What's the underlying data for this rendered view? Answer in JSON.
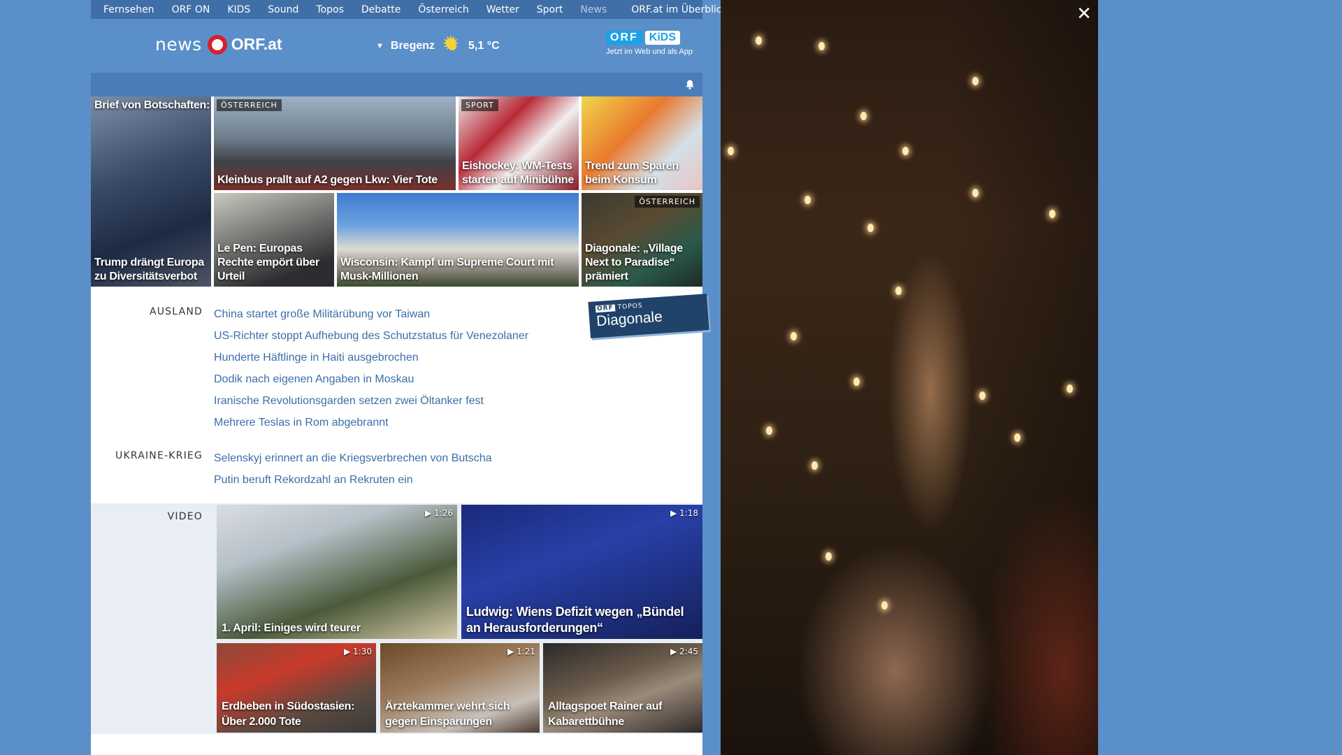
{
  "topnav": {
    "items": [
      "Fernsehen",
      "ORF ON",
      "KIDS",
      "Sound",
      "Topos",
      "Debatte",
      "Österreich",
      "Wetter",
      "Sport",
      "News"
    ],
    "overview": "ORF.at im Überblick"
  },
  "header": {
    "logo_news": "news",
    "logo_orf": "ORF.at",
    "weather_location": "Bregenz",
    "weather_temp": "5,1 °C",
    "kids_badge_orf": "ORF",
    "kids_badge_kids": "KiDS",
    "kids_sub": "Jetzt im Web und als App"
  },
  "tiles": [
    {
      "top": "Brief von Botschaften:",
      "caption": "Trump drängt Europa zu Diversitätsverbot"
    },
    {
      "tag": "ÖSTERREICH",
      "caption": "Kleinbus prallt auf A2 gegen Lkw: Vier Tote"
    },
    {
      "tag": "SPORT",
      "caption": "Eishockey: WM-Tests starten auf Minibühne"
    },
    {
      "caption": "Trend zum Sparen beim Konsum"
    },
    {
      "caption": "Le Pen: Europas Rechte empört über Urteil"
    },
    {
      "caption": "Wisconsin: Kampf um Supreme Court mit Musk-Millionen"
    },
    {
      "tag": "ÖSTERREICH",
      "caption": "Diagonale: „Village Next to Paradise“ prämiert"
    }
  ],
  "ausland": {
    "label": "AUSLAND",
    "items": [
      "China startet große Militärübung vor Taiwan",
      "US-Richter stoppt Aufhebung des Schutzstatus für Venezolaner",
      "Hunderte Häftlinge in Haiti ausgebrochen",
      "Dodik nach eigenen Angaben in Moskau",
      "Iranische Revolutionsgarden setzen zwei Öltanker fest",
      "Mehrere Teslas in Rom abgebrannt"
    ]
  },
  "ukraine": {
    "label": "UKRAINE-KRIEG",
    "items": [
      "Selenskyj erinnert an die Kriegsverbrechen von Butscha",
      "Putin beruft Rekordzahl an Rekruten ein"
    ]
  },
  "topos": {
    "orf": "ORF",
    "small": "TOPOS",
    "big": "Diagonale"
  },
  "video": {
    "label": "VIDEO",
    "items": [
      {
        "dur": "▶ 1:26",
        "caption": "1. April: Einiges wird teurer"
      },
      {
        "dur": "▶ 1:18",
        "caption": "Ludwig: Wiens Defizit wegen „Bündel an Herausforderungen“"
      },
      {
        "dur": "▶ 1:30",
        "caption": "Erdbeben in Südostasien: Über 2.000 Tote"
      },
      {
        "dur": "▶ 1:21",
        "caption": "Ärztekammer wehrt sich gegen Einsparungen"
      },
      {
        "dur": "▶ 2:45",
        "caption": "Alltagspoet Rainer auf Kabarettbühne"
      }
    ]
  },
  "player": {
    "close": "✕"
  }
}
